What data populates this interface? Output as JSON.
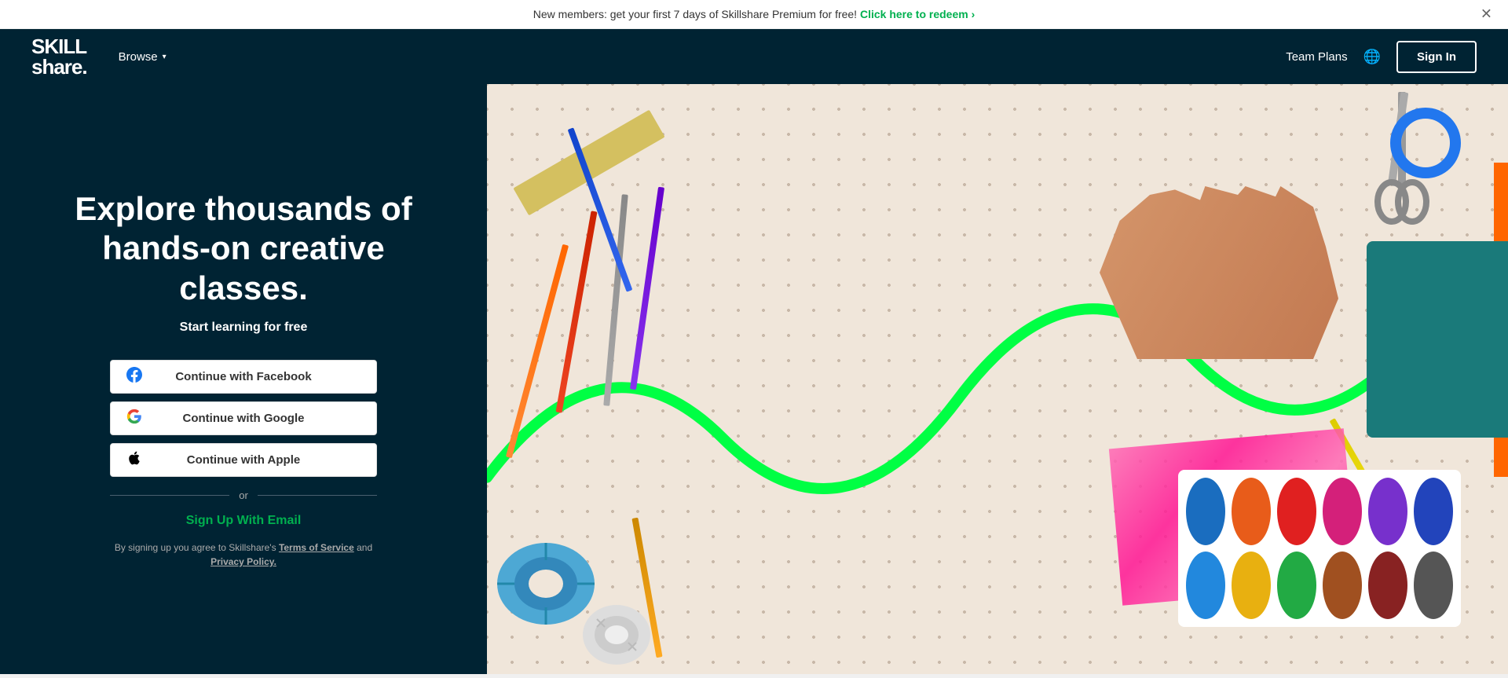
{
  "announcement": {
    "text": "New members: get your first 7 days of Skillshare Premium for free!",
    "link_text": "Click here to redeem",
    "link_arrow": "›"
  },
  "navbar": {
    "logo_line1": "SKILL",
    "logo_line2": "share.",
    "browse_label": "Browse",
    "team_plans_label": "Team Plans",
    "signin_label": "Sign In"
  },
  "hero": {
    "title": "Explore thousands of hands-on creative classes.",
    "subtitle": "Start learning for free"
  },
  "auth": {
    "facebook_label": "Continue with Facebook",
    "google_label": "Continue with Google",
    "apple_label": "Continue with Apple",
    "divider_text": "or",
    "email_label": "Sign Up With Email",
    "terms_text": "By signing up you agree to Skillshare's",
    "terms_link1": "Terms of Service",
    "terms_and": "and",
    "terms_link2": "Privacy Policy."
  },
  "palette_colors": [
    "#1a6dbf",
    "#e85c1a",
    "#e02020",
    "#d4207a",
    "#7730cc",
    "#2244bb",
    "#2288dd",
    "#e8b010",
    "#22aa44",
    "#a05020",
    "#882222",
    "#555555"
  ]
}
